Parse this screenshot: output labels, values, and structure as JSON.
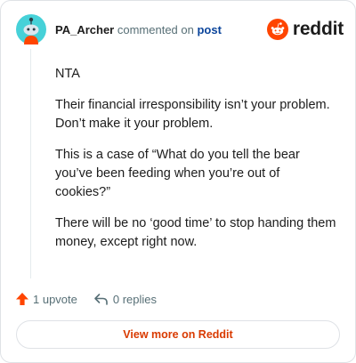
{
  "header": {
    "username": "PA_Archer",
    "commented_on": "commented on",
    "post_link": "post",
    "brand_word": "reddit",
    "brand_color": "#ff4500"
  },
  "comment": {
    "paragraphs": [
      "NTA",
      "Their financial irresponsibility isn’t your problem. Don’t make it your problem.",
      "This is a case of “What do you tell the bear you’ve been feeding when you’re out of cookies?”",
      "There will be no ‘good time’ to stop handing them money, except right now."
    ]
  },
  "actions": {
    "upvote_label": "1 upvote",
    "replies_label": "0 replies",
    "upvote_icon": "upvote-arrow-icon",
    "replies_icon": "reply-arrow-icon"
  },
  "footer": {
    "view_more_label": "View more on Reddit"
  }
}
